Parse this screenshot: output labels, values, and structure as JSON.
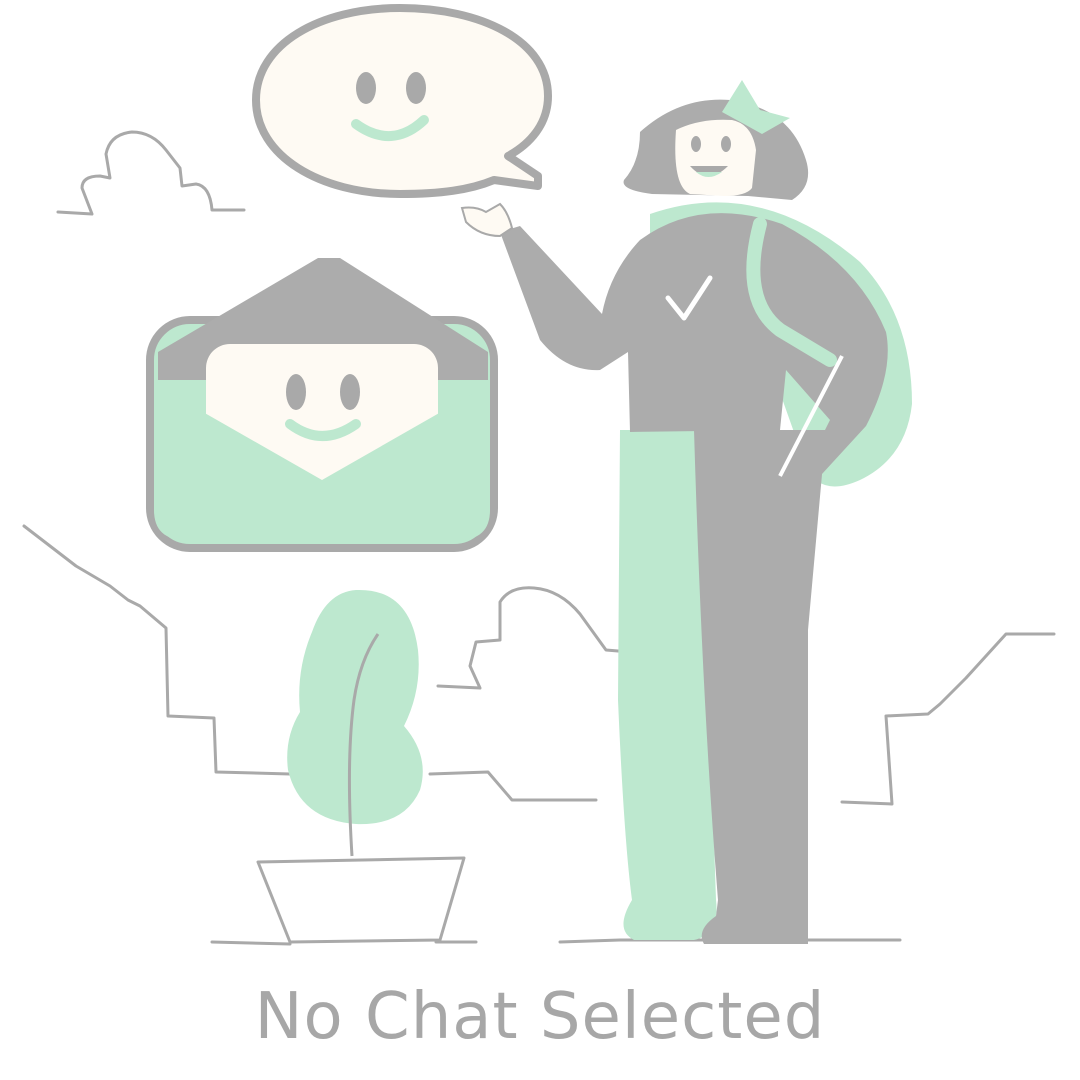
{
  "empty_state": {
    "title": "No Chat Selected",
    "illustration_icon": "girl-waving-with-chat-bubble-and-envelope-illustration"
  },
  "colors": {
    "background": "#ffffff",
    "accent_green": "#bde8cf",
    "gray": "#acacac",
    "cream": "#fefaf3",
    "text": "#a7a7a7"
  }
}
